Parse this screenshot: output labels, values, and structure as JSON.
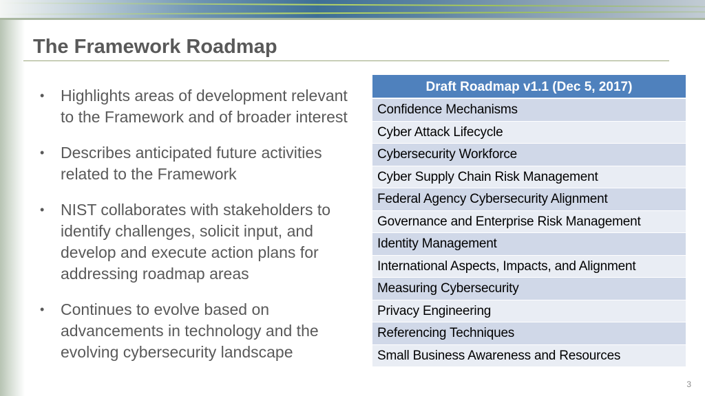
{
  "slide": {
    "title": "The Framework Roadmap",
    "page_number": "3",
    "bullets": [
      "Highlights areas of development relevant to the Framework and of broader interest",
      "Describes anticipated future activities related to the Framework",
      "NIST collaborates with stakeholders to identify challenges, solicit input, and develop and execute action plans for addressing roadmap areas",
      "Continues to evolve based on advancements in technology and the evolving cybersecurity landscape"
    ],
    "bullet_glyph": "•",
    "table": {
      "header": "Draft Roadmap v1.1 (Dec 5, 2017)",
      "header_color": "#4f81bd",
      "rows": [
        "Confidence Mechanisms",
        "Cyber Attack Lifecycle",
        "Cybersecurity Workforce",
        "Cyber Supply Chain Risk Management",
        "Federal Agency Cybersecurity Alignment",
        "Governance and Enterprise Risk Management",
        "Identity Management",
        "International Aspects, Impacts, and Alignment",
        "Measuring Cybersecurity",
        "Privacy Engineering",
        "Referencing Techniques",
        "Small Business Awareness and Resources"
      ]
    }
  }
}
